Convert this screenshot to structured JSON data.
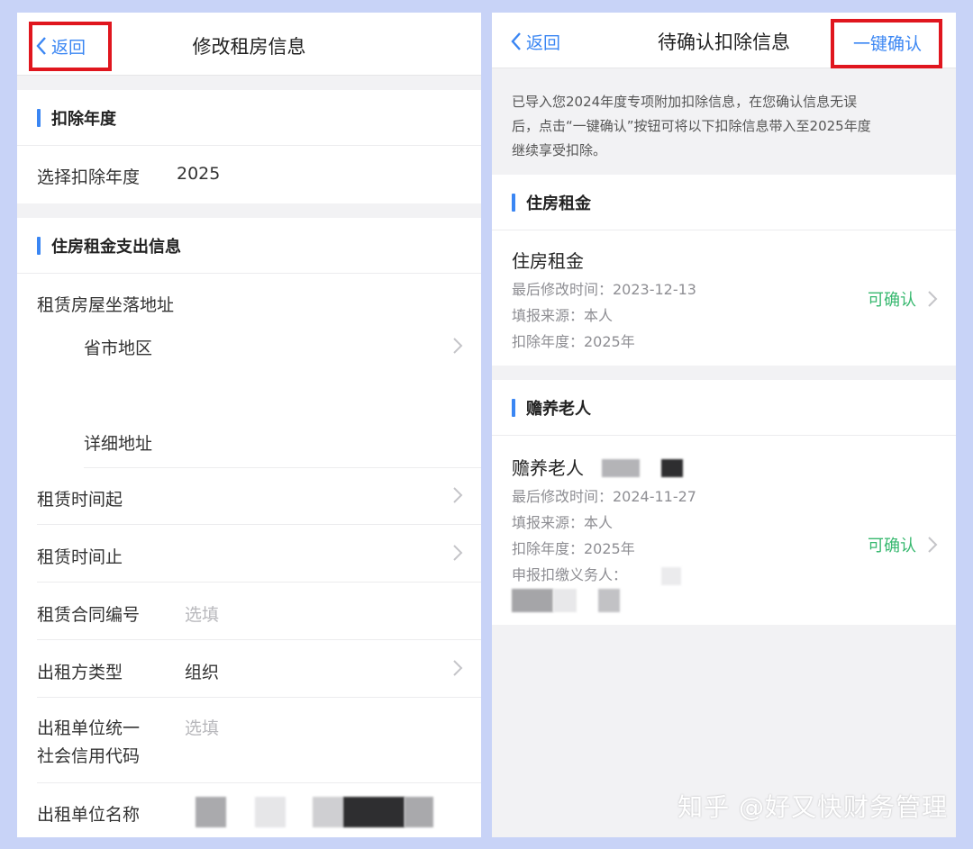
{
  "left": {
    "back_label": "返回",
    "title": "修改租房信息",
    "section_year": "扣除年度",
    "year_label": "选择扣除年度",
    "year_value": "2025",
    "section_rent": "住房租金支出信息",
    "address_label": "租赁房屋坐落地址",
    "province_label": "省市地区",
    "detail_label": "详细地址",
    "start_label": "租赁时间起",
    "end_label": "租赁时间止",
    "contract_label": "租赁合同编号",
    "contract_placeholder": "选填",
    "lessor_type_label": "出租方类型",
    "lessor_type_value": "组织",
    "credit_label_1": "出租单位统一",
    "credit_label_2": "社会信用代码",
    "credit_placeholder": "选填",
    "lessor_name_label": "出租单位名称"
  },
  "right": {
    "back_label": "返回",
    "title": "待确认扣除信息",
    "one_click_label": "一键确认",
    "notice_line1": "已导入您2024年度专项附加扣除信息，在您确认信息无误",
    "notice_line2": "后，点击“一键确认”按钮可将以下扣除信息带入至2025年度",
    "notice_line3": "继续享受扣除。",
    "section_rent": "住房租金",
    "rent_card": {
      "title": "住房租金",
      "modified": "最后修改时间：2023-12-13",
      "source": "填报来源：本人",
      "year": "扣除年度：2025年",
      "status": "可确认"
    },
    "section_elder": "赡养老人",
    "elder_card": {
      "title": "赡养老人",
      "modified": "最后修改时间：2024-11-27",
      "source": "填报来源：本人",
      "year": "扣除年度：2025年",
      "withholder": "申报扣缴义务人：",
      "status": "可确认"
    }
  },
  "watermark": "知乎 @好又快财务管理",
  "colors": {
    "accent": "#3a86f3",
    "confirm": "#37b86f",
    "highlight": "#e0161e",
    "frame": "#c8d3f7"
  }
}
